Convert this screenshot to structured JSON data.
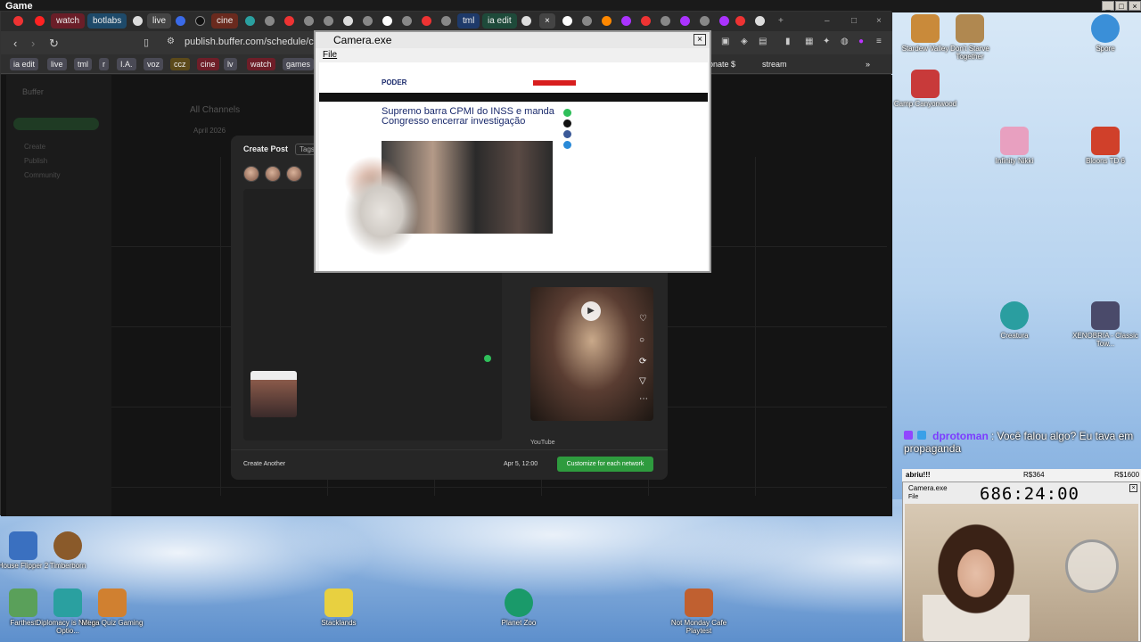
{
  "os": {
    "title": "Game"
  },
  "browser": {
    "tabs": [
      "watch",
      "botlabs",
      "live",
      "cine",
      "tml",
      "ia edit"
    ],
    "url": "publish.buffer.com/schedule/calendar",
    "bookmarks": [
      "ia edit",
      "live",
      "tml",
      "r",
      "I.A.",
      "voz",
      "ccz",
      "cine",
      "lv",
      "watch",
      "games"
    ],
    "bookmarks_right": [
      "onate $",
      "stream"
    ]
  },
  "buffer": {
    "app_name": "Buffer",
    "header_title": "All Channels",
    "month": "April 2026",
    "sidebar_items": [
      "Create",
      "Publish",
      "Community"
    ],
    "modal": {
      "title": "Create Post",
      "tags_label": "Tags",
      "preview_network": "YouTube",
      "create_another": "Create Another",
      "schedule_date": "Apr 5, 12:00",
      "customize_button": "Customize for each network"
    }
  },
  "camera_window": {
    "title": "Camera.exe",
    "menu": "File",
    "news_logo": "PODER",
    "headline": "Supremo barra CPMI do INSS e manda Congresso encerrar investigação"
  },
  "desktop_icons": [
    {
      "label": "Stardew Valley",
      "color": "#c98a3a"
    },
    {
      "label": "Don't Starve Together",
      "color": "#b08850"
    },
    {
      "label": "Spore",
      "color": "#3a8fd8"
    },
    {
      "label": "Camp Canyonwood",
      "color": "#c83a3a"
    },
    {
      "label": "Infinity Nikki",
      "color": "#e8a0c0"
    },
    {
      "label": "Bloons TD 6",
      "color": "#d0402a"
    },
    {
      "label": "Creatura",
      "color": "#2a9ea0"
    },
    {
      "label": "XENOBRIA - Classic Tow...",
      "color": "#4a4a6a"
    },
    {
      "label": "House Flipper 2",
      "color": "#3a70c0"
    },
    {
      "label": "Timberborn",
      "color": "#8a5a2a"
    },
    {
      "label": "Farthest",
      "color": "#5aa05a"
    },
    {
      "label": "Diplomacy is Not an Optio...",
      "color": "#2aa0a0"
    },
    {
      "label": "Mega Quiz Gaming",
      "color": "#d08030"
    },
    {
      "label": "Stacklands",
      "color": "#e8d040"
    },
    {
      "label": "Planet Zoo",
      "color": "#1a9a6a"
    },
    {
      "label": "Not Monday Cafe Playtest",
      "color": "#c06030"
    }
  ],
  "chat": {
    "user": "dprotoman",
    "message": ": Você falou algo? Eu tava em propaganda"
  },
  "stream_bar": {
    "left": "abriu!!!",
    "mid": "R$364",
    "right": "R$1600"
  },
  "camera2": {
    "title": "Camera.exe",
    "menu": "File",
    "timer": "686:24:00"
  }
}
